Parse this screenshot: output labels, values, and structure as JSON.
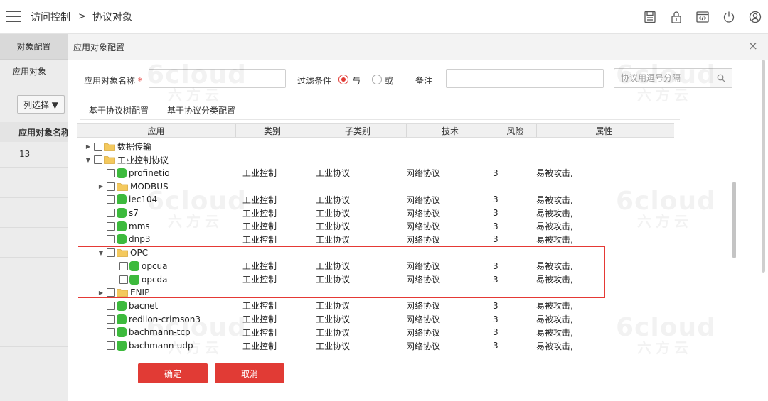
{
  "header": {
    "breadcrumb": [
      "访问控制",
      "协议对象"
    ],
    "breadcrumb_separator": ">",
    "icons": [
      "save-icon",
      "lock-icon",
      "code-icon",
      "power-icon",
      "user-icon"
    ]
  },
  "left_panel": {
    "tab_label": "对象配置",
    "nav_item": "应用对象",
    "column_select_label": "列选择 ▼",
    "column_header": "应用对象名称",
    "row_value": "13"
  },
  "dialog": {
    "title": "应用对象配置",
    "close_glyph": "×",
    "name_label": "应用对象名称",
    "required_mark": "*",
    "filter_label": "过滤条件",
    "filter_options": [
      "与",
      "或"
    ],
    "filter_selected": "与",
    "remark_label": "备注",
    "search_placeholder": "协议用逗号分隔",
    "tabs": [
      "基于协议树配置",
      "基于协议分类配置"
    ],
    "active_tab": "基于协议树配置",
    "confirm_label": "确定",
    "cancel_label": "取消"
  },
  "table": {
    "columns": [
      "应用",
      "类别",
      "子类别",
      "技术",
      "风险",
      "属性"
    ],
    "rows": [
      {
        "level": 0,
        "kind": "folder",
        "expand": "right",
        "name": "数据传输",
        "cells": [
          "",
          "",
          "",
          "",
          ""
        ]
      },
      {
        "level": 0,
        "kind": "folder",
        "expand": "down",
        "name": "工业控制协议",
        "cells": [
          "",
          "",
          "",
          "",
          ""
        ]
      },
      {
        "level": 1,
        "kind": "leaf",
        "expand": "",
        "name": "profinetio",
        "cells": [
          "工业控制",
          "工业协议",
          "网络协议",
          "3",
          "易被攻击,"
        ]
      },
      {
        "level": 1,
        "kind": "folder",
        "expand": "right",
        "name": "MODBUS",
        "cells": [
          "",
          "",
          "",
          "",
          ""
        ]
      },
      {
        "level": 1,
        "kind": "leaf",
        "expand": "",
        "name": "iec104",
        "cells": [
          "工业控制",
          "工业协议",
          "网络协议",
          "3",
          "易被攻击,"
        ]
      },
      {
        "level": 1,
        "kind": "leaf",
        "expand": "",
        "name": "s7",
        "cells": [
          "工业控制",
          "工业协议",
          "网络协议",
          "3",
          "易被攻击,"
        ]
      },
      {
        "level": 1,
        "kind": "leaf",
        "expand": "",
        "name": "mms",
        "cells": [
          "工业控制",
          "工业协议",
          "网络协议",
          "3",
          "易被攻击,"
        ]
      },
      {
        "level": 1,
        "kind": "leaf",
        "expand": "",
        "name": "dnp3",
        "cells": [
          "工业控制",
          "工业协议",
          "网络协议",
          "3",
          "易被攻击,"
        ]
      },
      {
        "level": 1,
        "kind": "folder",
        "expand": "down",
        "name": "OPC",
        "cells": [
          "",
          "",
          "",
          "",
          ""
        ]
      },
      {
        "level": 2,
        "kind": "leaf",
        "expand": "",
        "name": "opcua",
        "cells": [
          "工业控制",
          "工业协议",
          "网络协议",
          "3",
          "易被攻击,"
        ]
      },
      {
        "level": 2,
        "kind": "leaf",
        "expand": "",
        "name": "opcda",
        "cells": [
          "工业控制",
          "工业协议",
          "网络协议",
          "3",
          "易被攻击,"
        ]
      },
      {
        "level": 1,
        "kind": "folder",
        "expand": "right",
        "name": "ENIP",
        "cells": [
          "",
          "",
          "",
          "",
          ""
        ]
      },
      {
        "level": 1,
        "kind": "leaf",
        "expand": "",
        "name": "bacnet",
        "cells": [
          "工业控制",
          "工业协议",
          "网络协议",
          "3",
          "易被攻击,"
        ]
      },
      {
        "level": 1,
        "kind": "leaf",
        "expand": "",
        "name": "redlion-crimson3",
        "cells": [
          "工业控制",
          "工业协议",
          "网络协议",
          "3",
          "易被攻击,"
        ]
      },
      {
        "level": 1,
        "kind": "leaf",
        "expand": "",
        "name": "bachmann-tcp",
        "cells": [
          "工业控制",
          "工业协议",
          "网络协议",
          "3",
          "易被攻击,"
        ]
      },
      {
        "level": 1,
        "kind": "leaf",
        "expand": "",
        "name": "bachmann-udp",
        "cells": [
          "工业控制",
          "工业协议",
          "网络协议",
          "3",
          "易被攻击,"
        ]
      }
    ]
  },
  "watermark": {
    "line1": "6cloud",
    "line2": "六方云"
  },
  "colors": {
    "accent": "#e13b35",
    "leaf_icon": "#3dba3d",
    "folder": "#f4c95d",
    "highlight": "#e53935"
  }
}
